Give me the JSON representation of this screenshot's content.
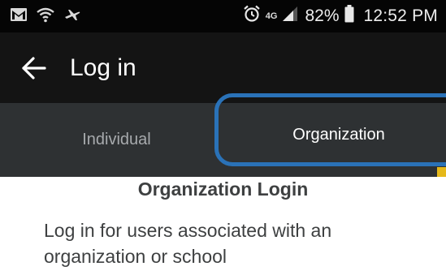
{
  "status_bar": {
    "network": "4G",
    "battery": "82%",
    "time": "12:52 PM",
    "icons": [
      "gmail-icon",
      "wifi-call-icon",
      "airplane-icon",
      "alarm-icon",
      "lte-icon",
      "signal-icon",
      "battery-icon"
    ]
  },
  "app_bar": {
    "title": "Log in",
    "back_icon": "arrow-left-icon"
  },
  "tabs": [
    {
      "label": "Individual",
      "selected": false
    },
    {
      "label": "Organization",
      "selected": true
    }
  ],
  "content": {
    "title": "Organization Login",
    "description": "Log in for users associated with an organization or school"
  },
  "colors": {
    "status_bar_bg": "#050505",
    "app_bar_bg": "#141414",
    "tab_bar_bg": "#2e3133",
    "highlight_border": "#2a72b8",
    "accent": "#e5b81a",
    "content_text": "#3e4041"
  }
}
